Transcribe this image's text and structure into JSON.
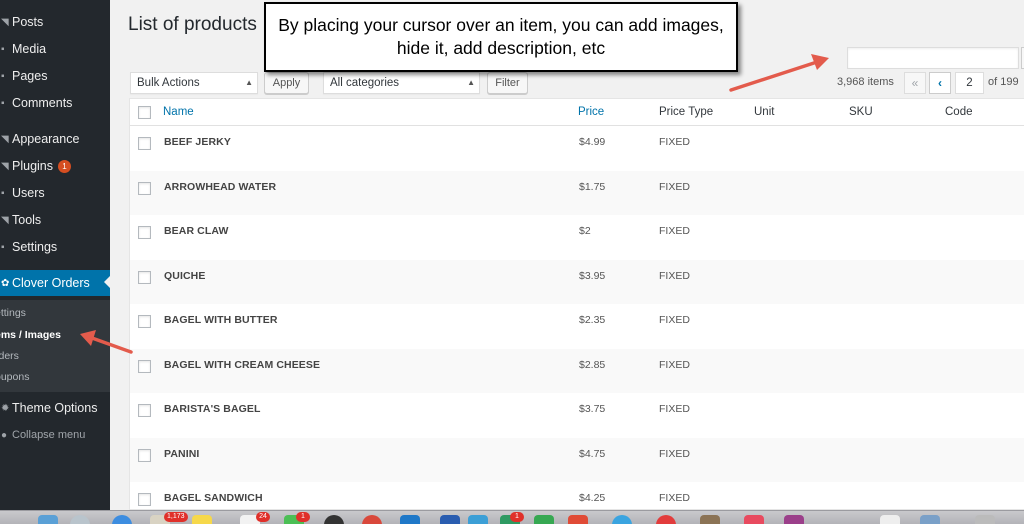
{
  "sidebar": {
    "items": [
      {
        "label": "Posts",
        "icon": "pin-icon"
      },
      {
        "label": "Media",
        "icon": "media-icon"
      },
      {
        "label": "Pages",
        "icon": "pages-icon"
      },
      {
        "label": "Comments",
        "icon": "comment-icon"
      },
      {
        "label": "Appearance",
        "icon": "brush-icon"
      },
      {
        "label": "Plugins",
        "icon": "plug-icon",
        "badge": "1"
      },
      {
        "label": "Users",
        "icon": "user-icon"
      },
      {
        "label": "Tools",
        "icon": "wrench-icon"
      },
      {
        "label": "Settings",
        "icon": "settings-icon"
      },
      {
        "label": "Clover Orders",
        "icon": "clover-icon"
      },
      {
        "label": "Theme Options",
        "icon": "gear-icon"
      },
      {
        "label": "Collapse menu",
        "icon": "collapse-icon"
      }
    ],
    "submenu": [
      "ettings",
      "ems / Images",
      "rders",
      "oupons"
    ]
  },
  "page": {
    "title": "List of products",
    "callout": "By placing your cursor over an item, you can add images, hide it, add description, etc"
  },
  "search": {
    "value": ""
  },
  "toolbar": {
    "bulk_actions": "Bulk Actions",
    "apply": "Apply",
    "categories": "All categories",
    "filter": "Filter"
  },
  "pagination": {
    "items": "3,968 items",
    "first": "«",
    "prev": "‹",
    "current": "2",
    "of": "of 199"
  },
  "table": {
    "columns": [
      "Name",
      "Price",
      "Price Type",
      "Unit",
      "SKU",
      "Code"
    ],
    "rows": [
      {
        "name": "BEEF JERKY",
        "price": "$4.99",
        "type": "FIXED"
      },
      {
        "name": "ARROWHEAD WATER",
        "price": "$1.75",
        "type": "FIXED"
      },
      {
        "name": "BEAR CLAW",
        "price": "$2",
        "type": "FIXED"
      },
      {
        "name": "QUICHE",
        "price": "$3.95",
        "type": "FIXED"
      },
      {
        "name": "BAGEL WITH BUTTER",
        "price": "$2.35",
        "type": "FIXED"
      },
      {
        "name": "BAGEL WITH CREAM CHEESE",
        "price": "$2.85",
        "type": "FIXED"
      },
      {
        "name": "BARISTA'S BAGEL",
        "price": "$3.75",
        "type": "FIXED"
      },
      {
        "name": "PANINI",
        "price": "$4.75",
        "type": "FIXED"
      },
      {
        "name": "BAGEL SANDWICH",
        "price": "$4.25",
        "type": "FIXED"
      }
    ]
  },
  "dock": {
    "badges": [
      "1,173",
      "24",
      "1",
      "1"
    ]
  },
  "colors": {
    "sidebar_bg": "#23282d",
    "active": "#0073aa",
    "arrow": "#e35b4c",
    "badge": "#d54e21"
  }
}
